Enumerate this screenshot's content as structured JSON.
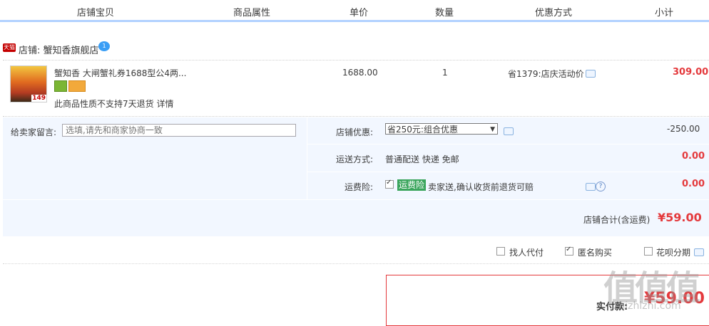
{
  "columns": [
    "店铺宝贝",
    "商品属性",
    "单价",
    "数量",
    "优惠方式",
    "小计"
  ],
  "shop": {
    "tmall_tag": "天猫",
    "label": "店铺: 蟹知香旗舰店",
    "wangwang": "1"
  },
  "item": {
    "thumb_tag": "149",
    "title": "蟹知香 大闸蟹礼券1688型公4两...",
    "no_return": "此商品性质不支持7天退货 详情",
    "unit_price": "1688.00",
    "quantity": "1",
    "promo": "省1379:店庆活动价",
    "subtotal": "309.00"
  },
  "message": {
    "label": "给卖家留言:",
    "placeholder": "选填,请先和商家协商一致"
  },
  "shop_discount": {
    "label": "店铺优惠:",
    "selected": "省250元:组合优惠",
    "value": "-250.00"
  },
  "shipping": {
    "label": "运送方式:",
    "method": "普通配送 快递 免邮",
    "value": "0.00"
  },
  "insurance": {
    "label": "运费险:",
    "tag": "运费险",
    "desc": "卖家送,确认收货前退货可赔",
    "value": "0.00"
  },
  "shop_total": {
    "label": "店铺合计(含运费)",
    "value": "¥59.00"
  },
  "options": {
    "pay_for_me": "找人代付",
    "anonymous": "匿名购买",
    "huabei": "花呗分期"
  },
  "paid": {
    "label": "实付款:",
    "value": "¥59.00"
  },
  "watermark": {
    "text": "值值值",
    "sub": "zhizhizhi.com"
  }
}
